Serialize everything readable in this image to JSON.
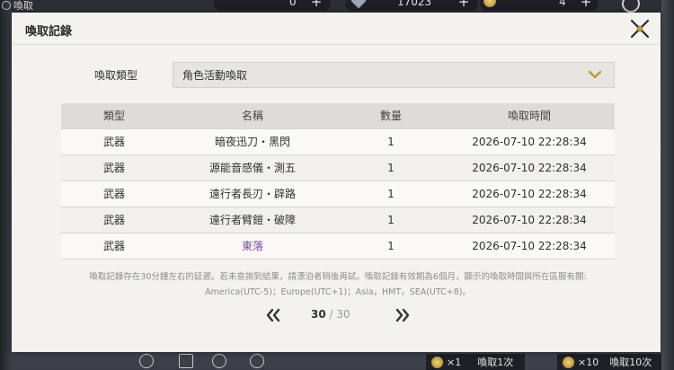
{
  "hud": {
    "title": "喚取",
    "currency_a": "0",
    "currency_b": "17023",
    "currency_c": "4",
    "plus": "+",
    "bottom_btn1_count": "×1",
    "bottom_btn1_label": "喚取1次",
    "bottom_btn2_count": "×10",
    "bottom_btn2_label": "喚取10次"
  },
  "dialog": {
    "title": "喚取記錄",
    "type_label": "喚取類型",
    "type_value": "角色活動喚取",
    "headers": {
      "type": "類型",
      "name": "名稱",
      "qty": "數量",
      "time": "喚取時間"
    },
    "rows": [
      {
        "type": "武器",
        "name": "暗夜迅刀・黑閃",
        "qty": "1",
        "time": "2026-07-10 22:28:34"
      },
      {
        "type": "武器",
        "name": "源能音感儀・測五",
        "qty": "1",
        "time": "2026-07-10 22:28:34"
      },
      {
        "type": "武器",
        "name": "遠行者長刃・辟路",
        "qty": "1",
        "time": "2026-07-10 22:28:34"
      },
      {
        "type": "武器",
        "name": "遠行者臂鎧・破障",
        "qty": "1",
        "time": "2026-07-10 22:28:34"
      },
      {
        "type": "武器",
        "name": "東落",
        "qty": "1",
        "time": "2026-07-10 22:28:34"
      }
    ],
    "note_line1": "喚取記錄存在30分鐘左右的延遲。若未查詢到結果，請漂泊者稍後再試。喚取記錄有效期為6個月，顯示的喚取時間與所在區服有關:",
    "note_line2": "America(UTC-5)；Europe(UTC+1)；Asia，HMT，SEA(UTC+8)。",
    "pager": {
      "current": "30",
      "separator": "/",
      "total": "30"
    }
  },
  "colors": {
    "panel": "#f3f2ef",
    "header_row": "#dedcd8",
    "rare_item": "#7a4aa0",
    "accent_gold": "#b99a3c"
  }
}
